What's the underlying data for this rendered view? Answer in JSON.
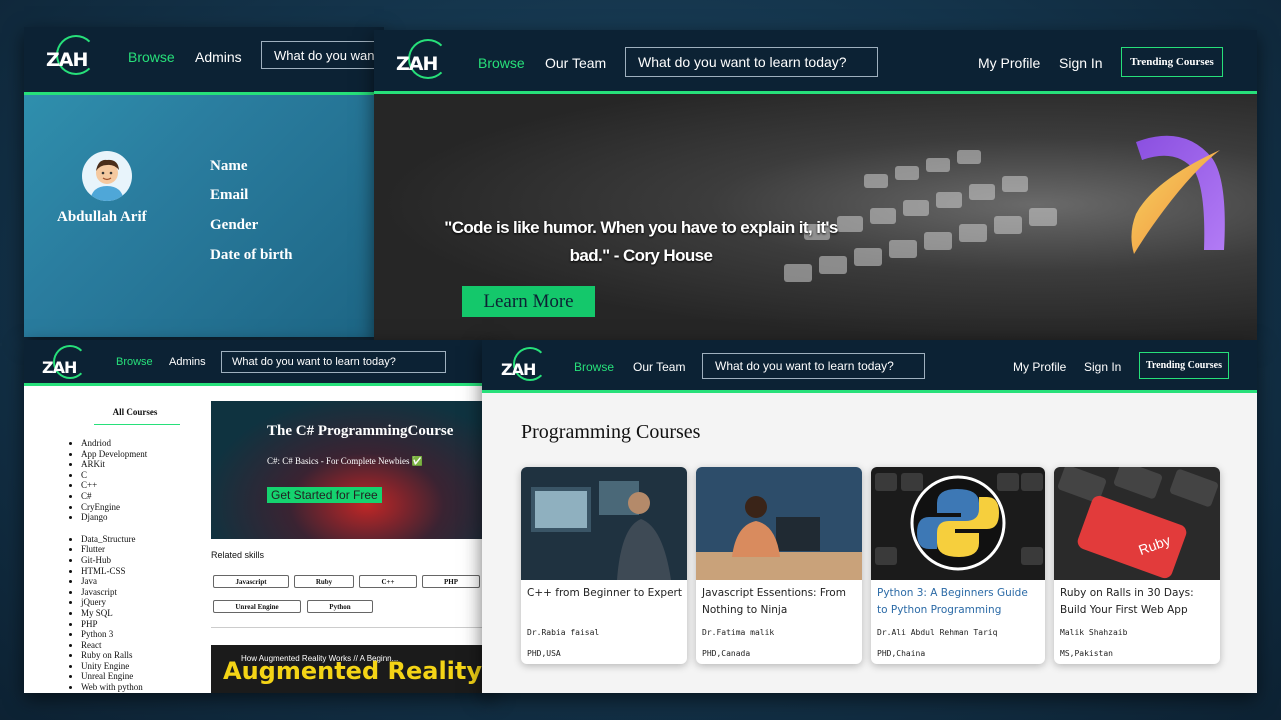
{
  "brand": {
    "logo": "ZAH"
  },
  "colors": {
    "accent": "#27e07a",
    "nav_bg": "#0c2234"
  },
  "profile_panel": {
    "nav": {
      "browse": "Browse",
      "admins": "Admins",
      "search_placeholder": "What do you want to learn today?"
    },
    "name": "Abdullah Arif",
    "fields": [
      "Name",
      "Email",
      "Gender",
      "Date of birth"
    ]
  },
  "hero_panel": {
    "nav": {
      "browse": "Browse",
      "team": "Our Team",
      "search_placeholder": "What do you want to learn today?",
      "profile": "My Profile",
      "sign_in": "Sign In",
      "trending": "Trending Courses"
    },
    "quote": "\"Code is like humor. When you have to explain it, it's bad.\" - Cory House",
    "cta": "Learn More",
    "brand_icon": "a-letter-icon"
  },
  "courses_panel": {
    "nav": {
      "browse": "Browse",
      "admins": "Admins",
      "search_placeholder": "What do you want to learn today?"
    },
    "sidebar_title": "All Courses",
    "group1": [
      "Andriod",
      "App Development",
      "ARKit",
      "C",
      "C++",
      "C#",
      "CryEngine",
      "Django"
    ],
    "group2": [
      "Data_Structure",
      "Flutter",
      "Git-Hub",
      "HTML-CSS",
      "Java",
      "Javascript",
      "jQuery",
      "My SQL",
      "PHP",
      "Python 3",
      "React",
      "Ruby on Ralls",
      "Unity Engine",
      "Unreal Engine",
      "Web with python"
    ],
    "banner": {
      "title": "The C# ProgrammingCourse",
      "subtitle": "C#: C# Basics - For Complete Newbies ✅",
      "button": "Get Started for Free"
    },
    "related_title": "Related skills",
    "skills": [
      "Javascript",
      "Ruby",
      "C++",
      "PHP",
      "Unreal Engine",
      "Python"
    ],
    "video": {
      "title": "How Augmented Reality Works // A Beginn...",
      "banner_text": "Augmented Reality"
    }
  },
  "programming_panel": {
    "nav": {
      "browse": "Browse",
      "team": "Our Team",
      "search_placeholder": "What do you want to learn today?",
      "profile": "My Profile",
      "sign_in": "Sign In",
      "trending": "Trending Courses"
    },
    "title": "Programming Courses",
    "cards": [
      {
        "title": "C++ from Beginner to Expert",
        "author": "Dr.Rabia faisal",
        "degree": "PHD,USA"
      },
      {
        "title": "Javascript Essentions: From Nothing to Ninja",
        "author": "Dr.Fatima malik",
        "degree": "PHD,Canada"
      },
      {
        "title": "Python 3: A Beginners Guide to Python Programming",
        "author": "Dr.Ali Abdul Rehman Tariq",
        "degree": "PHD,Chaina"
      },
      {
        "title": "Ruby on Ralls in 30 Days: Build Your First Web App",
        "author": "Malik Shahzaib",
        "degree": "MS,Pakistan",
        "img_text": "Ruby"
      }
    ]
  }
}
